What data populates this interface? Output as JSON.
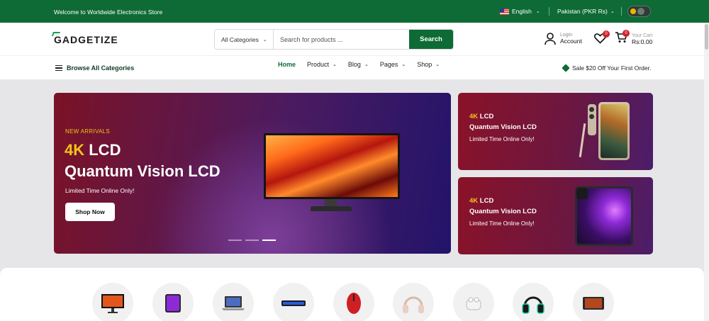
{
  "topbar": {
    "welcome": "Welcome to Worldwide Electronics Store",
    "language": "English",
    "currency": "Pakistan (PKR Rs)"
  },
  "header": {
    "logo": "GADGETIZE",
    "search": {
      "category": "All Categories",
      "placeholder": "Search for products ...",
      "button": "Search"
    },
    "account": {
      "small": "Login",
      "big": "Account"
    },
    "wishlist": {
      "count": "0"
    },
    "cart": {
      "count": "0",
      "small": "Your Cart",
      "big": "Rs:0.00"
    }
  },
  "nav": {
    "browse": "Browse All Categories",
    "items": [
      {
        "label": "Home",
        "active": true
      },
      {
        "label": "Product"
      },
      {
        "label": "Blog"
      },
      {
        "label": "Pages"
      },
      {
        "label": "Shop"
      }
    ],
    "promo": "Sale $20 Off Your First Order."
  },
  "hero": {
    "kicker": "NEW ARRIVALS",
    "title_accent": "4K",
    "title_rest": " LCD",
    "title_line2": "Quantum Vision LCD",
    "subtitle": "Limited Time Online Only!",
    "button": "Shop Now",
    "slides": 3,
    "active_slide": 3
  },
  "side_banners": [
    {
      "accent": "4K",
      "rest": " LCD",
      "line2": "Quantum Vision LCD",
      "line3": "Limited Time Online Only!",
      "product": "smartphone"
    },
    {
      "accent": "4K",
      "rest": " LCD",
      "line2": "Quantum Vision LCD",
      "line3": "Limited Time Online Only!",
      "product": "tablet"
    }
  ],
  "categories": [
    "monitor-icon",
    "tablet-icon",
    "laptop-icon",
    "keyboard-icon",
    "mouse-icon",
    "headphones-icon",
    "earbuds-icon",
    "gaming-headset-icon",
    "drawing-tablet-icon"
  ],
  "colors": {
    "brand": "#0e6b35",
    "accent": "#f2c31a",
    "badge": "#d0202a"
  }
}
